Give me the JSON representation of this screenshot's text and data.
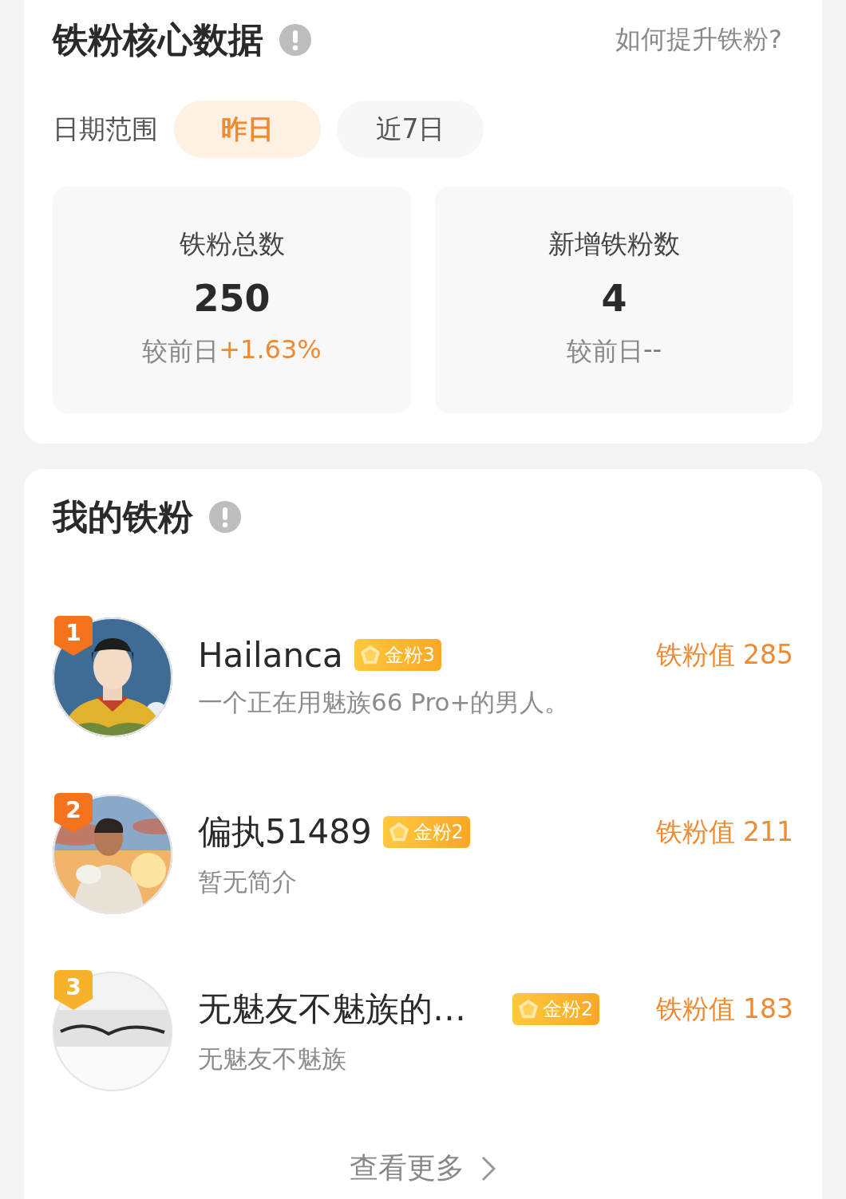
{
  "core_data": {
    "title": "铁粉核心数据",
    "help_link": "如何提升铁粉?",
    "date_range": {
      "label": "日期范围",
      "options": [
        {
          "label": "昨日",
          "selected": true
        },
        {
          "label": "近7日",
          "selected": false
        }
      ]
    },
    "stats": [
      {
        "label": "铁粉总数",
        "value": "250",
        "compare_label": "较前日",
        "change": "+1.63%",
        "kind": "up"
      },
      {
        "label": "新增铁粉数",
        "value": "4",
        "compare_label": "较前日",
        "change": "--",
        "kind": "none"
      }
    ]
  },
  "my_fans": {
    "title": "我的铁粉",
    "fans": [
      {
        "rank": "1",
        "color": "#f4731f",
        "name": "Hailanca",
        "level_badge": "金粉3",
        "score": "铁粉值 285",
        "bio": "一个正在用魅族66 Pro+的男人。"
      },
      {
        "rank": "2",
        "color": "#f4731f",
        "name": "偏执51489",
        "level_badge": "金粉2",
        "score": "铁粉值 211",
        "bio": "暂无简介"
      },
      {
        "rank": "3",
        "color": "#f6b22a",
        "name": "无魅友不魅族的…",
        "level_badge": "金粉2",
        "score": "铁粉值 183",
        "bio": "无魅友不魅族"
      }
    ],
    "more": "查看更多"
  }
}
